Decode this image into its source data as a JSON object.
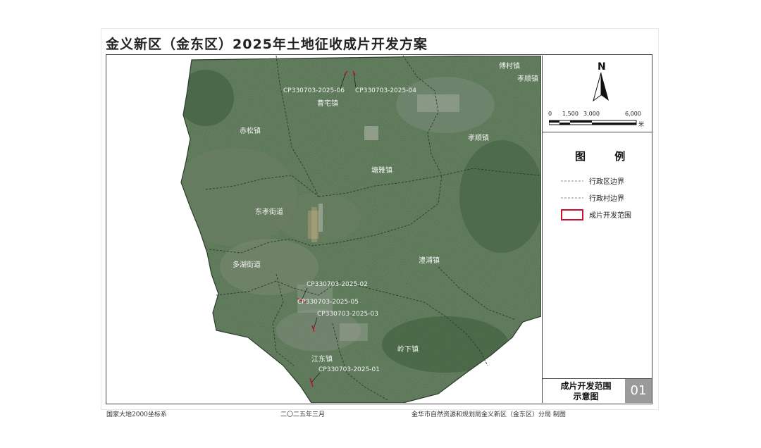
{
  "title": "金义新区（金东区）2025年土地征收成片开发方案",
  "north_label": "N",
  "scale": {
    "ticks": [
      "0",
      "1,500",
      "3,000",
      "6,000"
    ],
    "unit": "米"
  },
  "legend": {
    "title": "图 例",
    "items": [
      {
        "label": "行政区边界",
        "symbol": "dashed-line"
      },
      {
        "label": "行政村边界",
        "symbol": "dashed-line"
      },
      {
        "label": "成片开发范围",
        "symbol": "red-rectangle"
      }
    ]
  },
  "map_caption": "成片开发范围示意图",
  "map_caption_line1": "成片开发范围",
  "map_caption_line2": "示意图",
  "sheet_number": "01",
  "footer": {
    "crs": "国家大地2000坐标系",
    "date": "二〇二五年三月",
    "authority": "金华市自然资源和规划局金义新区（金东区）分局  制图"
  },
  "places": [
    "傅村镇",
    "孝顺镇",
    "曹宅镇",
    "孝顺镇",
    "赤松镇",
    "塘雅镇",
    "东孝街道",
    "澧浦镇",
    "多湖街道",
    "岭下镇",
    "江东镇"
  ],
  "plots": [
    "CP330703-2025-06",
    "CP330703-2025-04",
    "CP330703-2025-02",
    "CP330703-2025-05",
    "CP330703-2025-03",
    "CP330703-2025-01"
  ],
  "colors": {
    "boundary_plot": "#d0021b",
    "imagery_base": "#4e6b4a",
    "frame": "#444444"
  }
}
